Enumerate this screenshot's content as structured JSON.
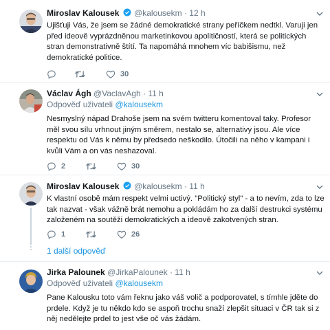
{
  "tweets": [
    {
      "name": "Miroslav Kalousek",
      "handle": "@kalousekm",
      "time": "· 12 h",
      "verified": true,
      "text": "Ujišťuji Vás, že jsem se žádné demokratické strany peříčkem nedtkl. Varuji jen před ideově vyprázdněnou marketinkovou apolitičností, která se politických stran demonstrativně štítí. Ta napomáhá mnohem víc babišismu, než demokratické politice.",
      "reply_count": "",
      "retweet_count": "",
      "like_count": "30"
    },
    {
      "name": "Václav Ágh",
      "handle": "@VaclavAgh",
      "time": "· 11 h",
      "verified": false,
      "reply_prefix": "Odpověď uživateli",
      "reply_user": "@kalousekm",
      "text": "Nesmyslný nápad Drahoše jsem na svém twitteru komentoval taky. Profesor měl svou sílu vrhnout jiným směrem, nestalo se, alternativy jsou. Ale více respektu od Vás k němu by předsedo neškodilo. Útočili na něho v kampani i kvůli Vám a on vás neshazoval.",
      "reply_count": "2",
      "retweet_count": "",
      "like_count": "30"
    },
    {
      "name": "Miroslav Kalousek",
      "handle": "@kalousekm",
      "time": "· 11 h",
      "verified": true,
      "text": "K vlastní osobě mám respekt velmi uctivý. \"Politický styl\" - a to nevím, zda to lze tak nazvat - však vážně brát nemohu a pokládám ho za další destrukci systému založeném na soutěži demokratických a ideově zakotvených stran.",
      "reply_count": "1",
      "retweet_count": "",
      "like_count": "26"
    },
    {
      "name": "Jirka Palounek",
      "handle": "@JirkaPalounek",
      "time": "· 11 h",
      "verified": false,
      "reply_prefix": "Odpověď uživateli",
      "reply_user": "@kalousekm",
      "text": "Pane Kalousku toto vám řeknu jako váš volič a podporovatel, s tímhle  jděte  do prdele. Když je tu někdo kdo se aspoň trochu snaží zlepšit situaci v ČR tak si z něj nedělejte prdel to jest vše oč vás žádám."
    }
  ],
  "more_replies": "1 další odpověď",
  "colors": {
    "accent": "#1b95e0",
    "muted": "#657786",
    "text": "#14171a",
    "divider": "#e6ecf0"
  },
  "icons": [
    "reply-icon",
    "retweet-icon",
    "like-icon",
    "verified-icon",
    "chevron-down-icon"
  ]
}
